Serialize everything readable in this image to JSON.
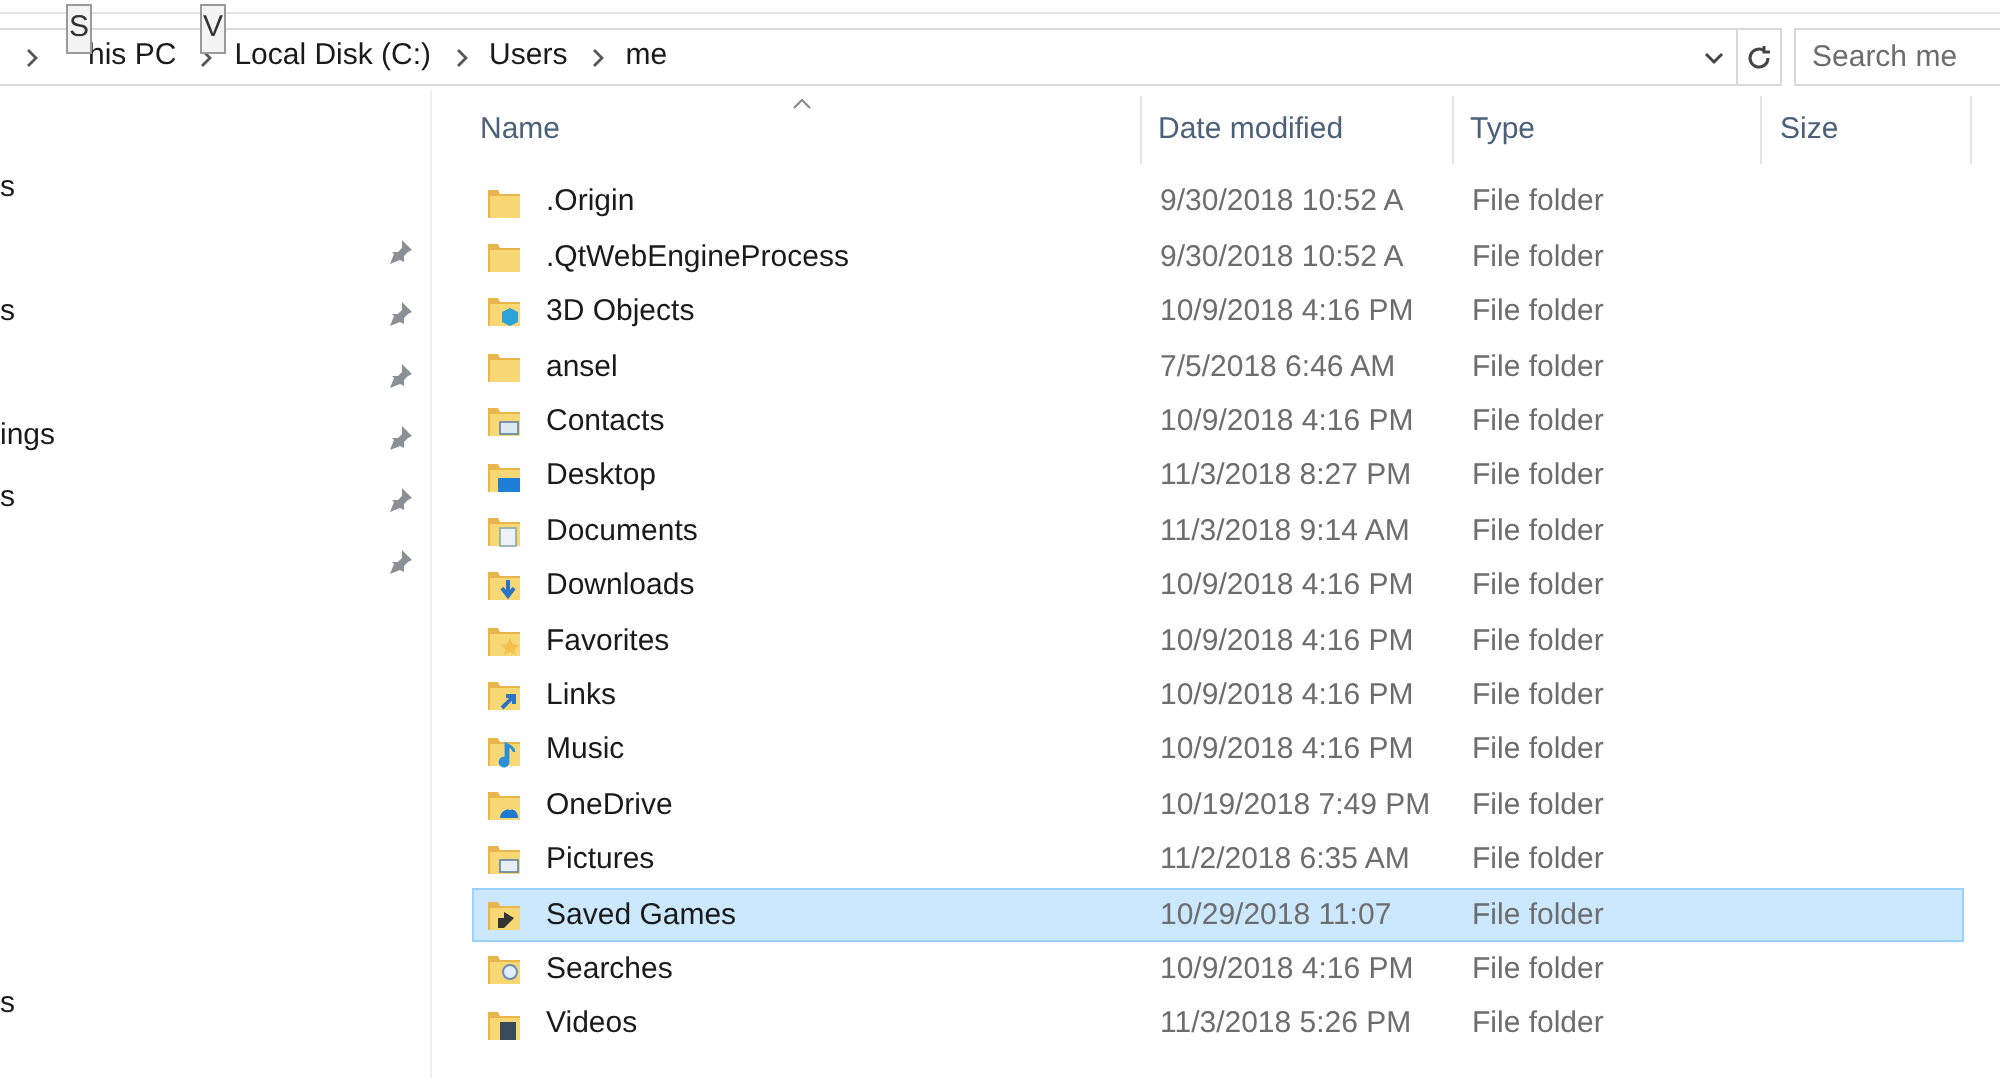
{
  "breadcrumb": [
    "his PC",
    "Local Disk (C:)",
    "Users",
    "me"
  ],
  "key_tips": [
    "S",
    "V"
  ],
  "search": {
    "placeholder": "Search me"
  },
  "sidebar": {
    "items": [
      {
        "label": "s",
        "pinned": false
      },
      {
        "pinned": true
      },
      {
        "label": "s",
        "pinned": true
      },
      {
        "pinned": true
      },
      {
        "label": "ings",
        "pinned": true
      },
      {
        "label": "s",
        "pinned": true
      },
      {
        "pinned": true
      }
    ],
    "bottom_item": "s"
  },
  "table": {
    "columns": [
      "Name",
      "Date modified",
      "Type",
      "Size"
    ],
    "rows": [
      {
        "name": ".Origin",
        "date": "9/30/2018 10:52 A",
        "type": "File folder",
        "selected": false
      },
      {
        "name": ".QtWebEngineProcess",
        "date": "9/30/2018 10:52 A",
        "type": "File folder",
        "selected": false
      },
      {
        "name": "3D Objects",
        "date": "10/9/2018 4:16 PM",
        "type": "File folder",
        "selected": false
      },
      {
        "name": "ansel",
        "date": "7/5/2018 6:46 AM",
        "type": "File folder",
        "selected": false
      },
      {
        "name": "Contacts",
        "date": "10/9/2018 4:16 PM",
        "type": "File folder",
        "selected": false
      },
      {
        "name": "Desktop",
        "date": "11/3/2018 8:27 PM",
        "type": "File folder",
        "selected": false
      },
      {
        "name": "Documents",
        "date": "11/3/2018 9:14 AM",
        "type": "File folder",
        "selected": false
      },
      {
        "name": "Downloads",
        "date": "10/9/2018 4:16 PM",
        "type": "File folder",
        "selected": false
      },
      {
        "name": "Favorites",
        "date": "10/9/2018 4:16 PM",
        "type": "File folder",
        "selected": false
      },
      {
        "name": "Links",
        "date": "10/9/2018 4:16 PM",
        "type": "File folder",
        "selected": false
      },
      {
        "name": "Music",
        "date": "10/9/2018 4:16 PM",
        "type": "File folder",
        "selected": false
      },
      {
        "name": "OneDrive",
        "date": "10/19/2018 7:49 PM",
        "type": "File folder",
        "selected": false
      },
      {
        "name": "Pictures",
        "date": "11/2/2018 6:35 AM",
        "type": "File folder",
        "selected": false
      },
      {
        "name": "Saved Games",
        "date": "10/29/2018 11:07",
        "type": "File folder",
        "selected": true
      },
      {
        "name": "Searches",
        "date": "10/9/2018 4:16 PM",
        "type": "File folder",
        "selected": false
      },
      {
        "name": "Videos",
        "date": "11/3/2018 5:26 PM",
        "type": "File folder",
        "selected": false
      }
    ]
  }
}
